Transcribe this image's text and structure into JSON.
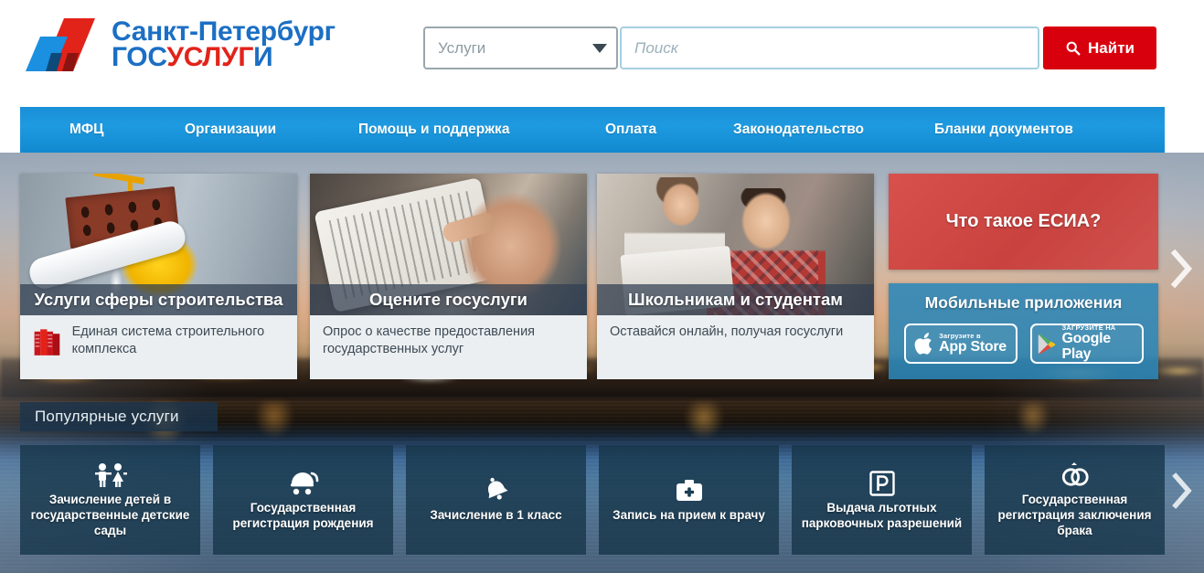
{
  "header": {
    "logo": {
      "line1": "Санкт-Петербург",
      "line2_part1": "ГОС",
      "line2_part2": "УСЛУГ",
      "line2_part3": "И",
      "colors": {
        "blue": "#1b6fc4",
        "red": "#e2231a"
      }
    },
    "service_select": {
      "value": "Услуги"
    },
    "search": {
      "placeholder": "Поиск",
      "value": ""
    },
    "find_button": {
      "label": "Найти",
      "color": "#d9000d",
      "icon": "search-icon"
    }
  },
  "nav": {
    "background": "#1e9ae0",
    "items": [
      {
        "label": "МФЦ"
      },
      {
        "label": "Организации"
      },
      {
        "label": "Помощь и поддержка"
      },
      {
        "label": "Оплата"
      },
      {
        "label": "Законодательство"
      },
      {
        "label": "Бланки документов"
      }
    ]
  },
  "carousel": {
    "cards": [
      {
        "title": "Услуги сферы строительства",
        "desc": "Единая система строительного комплекса",
        "has_logo": true,
        "logo_color": "#e2231a",
        "photo": "construction-photo"
      },
      {
        "title": "Оцените госуслуги",
        "desc": "Опрос о качестве предоставления государственных услуг",
        "has_logo": false,
        "photo": "tablet-hand-photo"
      },
      {
        "title": "Школьникам и студентам",
        "desc": "Оставайся онлайн, получая госуслуги",
        "has_logo": false,
        "photo": "students-photo"
      }
    ],
    "next_arrow": "chevron-right-icon"
  },
  "right_panel": {
    "esia": {
      "label": "Что такое ЕСИА?",
      "color": "#cf4a46"
    },
    "mobile": {
      "title": "Мобильные приложения",
      "color": "#2a86b8",
      "stores": [
        {
          "small": "Загрузите в",
          "big": "App Store",
          "icon": "apple-icon"
        },
        {
          "small": "ЗАГРУЗИТЕ НА",
          "big": "Google Play",
          "icon": "google-play-icon"
        }
      ]
    }
  },
  "popular": {
    "header": "Популярные услуги",
    "next_arrow": "chevron-right-icon",
    "tiles": [
      {
        "label": "Зачисление детей в государственные детские сады",
        "icon": "children-icon"
      },
      {
        "label": "Государственная регистрация рождения",
        "icon": "stroller-icon"
      },
      {
        "label": "Зачисление в 1 класс",
        "icon": "school-bell-icon"
      },
      {
        "label": "Запись на прием к врачу",
        "icon": "medical-bag-icon"
      },
      {
        "label": "Выдача льготных парковочных разрешений",
        "icon": "parking-icon"
      },
      {
        "label": "Государственная регистрация заключения брака",
        "icon": "wedding-rings-icon"
      }
    ]
  }
}
